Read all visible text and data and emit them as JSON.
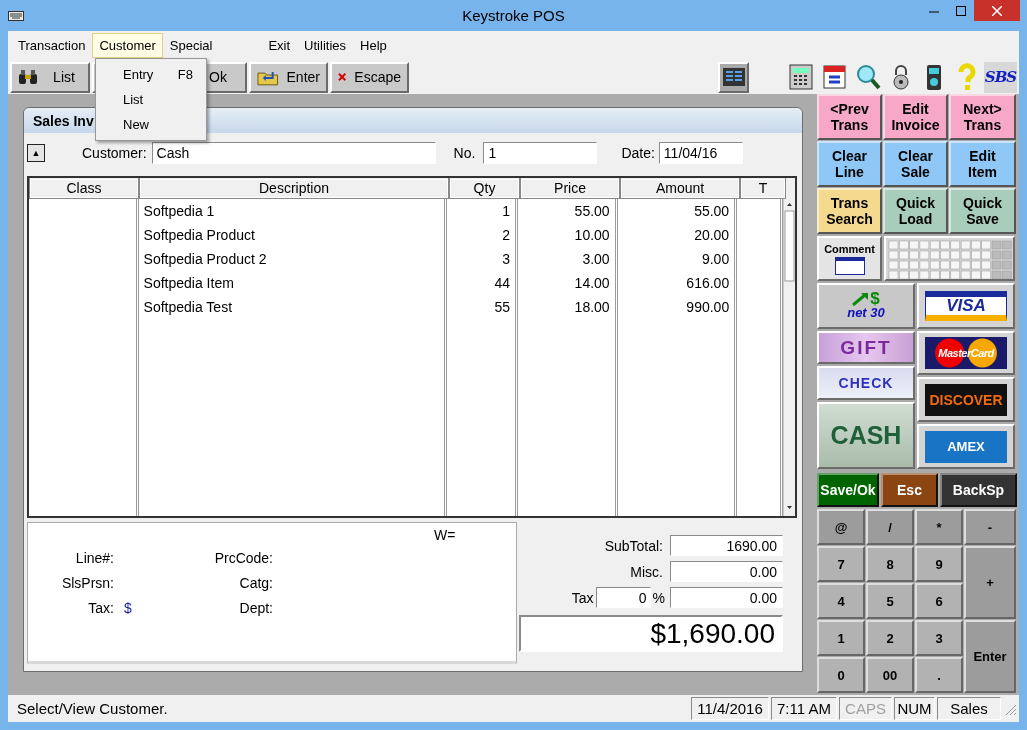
{
  "window": {
    "title": "Keystroke POS"
  },
  "menu": [
    {
      "label": "Transaction",
      "selected": false
    },
    {
      "label": "Customer",
      "selected": true
    },
    {
      "label": "Special",
      "selected": false
    },
    {
      "label": "Exit",
      "selected": false
    },
    {
      "label": "Utilities",
      "selected": false
    },
    {
      "label": "Help",
      "selected": false
    }
  ],
  "open_menu": {
    "items": [
      {
        "label": "Entry",
        "shortcut": "F8"
      },
      {
        "label": "List"
      },
      {
        "label": "New"
      }
    ]
  },
  "toolbar": {
    "buttons": [
      {
        "label": "List",
        "kind": "binoculars"
      },
      {
        "label": "Ok",
        "kind": "covered"
      },
      {
        "label": "Enter",
        "kind": "enter"
      },
      {
        "label": "Escape",
        "kind": "cancel"
      }
    ],
    "logo": "SBS"
  },
  "invoice": {
    "title": "Sales Inv",
    "scroll_up": "▲",
    "customer_label": "Customer:",
    "customer": "Cash",
    "number_label": "No.",
    "number": "1",
    "date_label": "Date:",
    "date": "11/04/16"
  },
  "table": {
    "columns": [
      "Class",
      "Description",
      "Qty",
      "Price",
      "Amount",
      "T"
    ],
    "rows": [
      {
        "description": "Softpedia 1",
        "qty": "1",
        "price": "55.00",
        "amount": "55.00"
      },
      {
        "description": "Softpedia Product",
        "qty": "2",
        "price": "10.00",
        "amount": "20.00"
      },
      {
        "description": "Softpedia Product 2",
        "qty": "3",
        "price": "3.00",
        "amount": "9.00"
      },
      {
        "description": "Softpedia Item",
        "qty": "44",
        "price": "14.00",
        "amount": "616.00"
      },
      {
        "description": "Softpedia Test",
        "qty": "55",
        "price": "18.00",
        "amount": "990.00"
      }
    ]
  },
  "line_details": {
    "weight_label": "W=",
    "left": [
      {
        "label": "Line#:"
      },
      {
        "label": "SlsPrsn:"
      },
      {
        "label": "Tax:",
        "value": "$"
      }
    ],
    "right": [
      {
        "label": "PrcCode:"
      },
      {
        "label": "Catg:"
      },
      {
        "label": "Dept:"
      }
    ]
  },
  "totals": {
    "subtotal_label": "SubTotal:",
    "subtotal": "1690.00",
    "misc_label": "Misc.",
    "misc": "0.00",
    "tax_label": "Tax",
    "tax_rate": "0",
    "percent": "%",
    "tax": "0.00",
    "total": "$1,690.00"
  },
  "function_buttons": [
    {
      "label": "<Prev Trans",
      "color": "#f7a8c9"
    },
    {
      "label": "Edit Invoice",
      "color": "#f7a8c9"
    },
    {
      "label": "Next> Trans",
      "color": "#f7a8c9"
    },
    {
      "label": "Clear Line",
      "color": "#8fc7f7"
    },
    {
      "label": "Clear Sale",
      "color": "#8fc7f7"
    },
    {
      "label": "Edit Item",
      "color": "#8fc7f7"
    },
    {
      "label": "Trans Search",
      "color": "#f5d98e"
    },
    {
      "label": "Quick Load",
      "color": "#a9cdbb"
    },
    {
      "label": "Quick Save",
      "color": "#a9cdbb"
    }
  ],
  "comment_button": "Comment",
  "payments_left": [
    {
      "kind": "net30",
      "label": "net 30",
      "symbol": "$"
    },
    {
      "kind": "gift",
      "label": "GIFT"
    },
    {
      "kind": "check",
      "label": "CHECK"
    },
    {
      "kind": "cash",
      "label": "CASH"
    }
  ],
  "payments_right": [
    {
      "kind": "visa",
      "label": "VISA"
    },
    {
      "kind": "mastercard",
      "label": "MasterCard"
    },
    {
      "kind": "discover",
      "label": "DISCOVER"
    },
    {
      "kind": "amex",
      "label": "AMEX"
    }
  ],
  "action_buttons": [
    {
      "label": "Save/Ok",
      "color": "#006400"
    },
    {
      "label": "Esc",
      "color": "#8b4513"
    },
    {
      "label": "BackSp",
      "color": "#333333"
    }
  ],
  "keypad": [
    {
      "label": "@",
      "kind": "op"
    },
    {
      "label": "/",
      "kind": "op"
    },
    {
      "label": "*",
      "kind": "op"
    },
    {
      "label": "-",
      "kind": "op"
    },
    {
      "label": "7",
      "kind": "digit"
    },
    {
      "label": "8",
      "kind": "digit"
    },
    {
      "label": "9",
      "kind": "digit"
    },
    {
      "label": "+",
      "kind": "tall"
    },
    {
      "label": "4",
      "kind": "digit"
    },
    {
      "label": "5",
      "kind": "digit"
    },
    {
      "label": "6",
      "kind": "digit"
    },
    {
      "label": "1",
      "kind": "digit"
    },
    {
      "label": "2",
      "kind": "digit"
    },
    {
      "label": "3",
      "kind": "digit"
    },
    {
      "label": "Enter",
      "kind": "tall"
    },
    {
      "label": "0",
      "kind": "digit"
    },
    {
      "label": "00",
      "kind": "digit"
    },
    {
      "label": ".",
      "kind": "digit"
    }
  ],
  "status_bar": {
    "message": "Select/View Customer.",
    "panels": [
      {
        "text": "11/4/2016",
        "disabled": false
      },
      {
        "text": "7:11 AM",
        "disabled": false
      },
      {
        "text": "CAPS",
        "disabled": true
      },
      {
        "text": "NUM",
        "disabled": false
      },
      {
        "text": "Sales",
        "disabled": false
      }
    ]
  }
}
